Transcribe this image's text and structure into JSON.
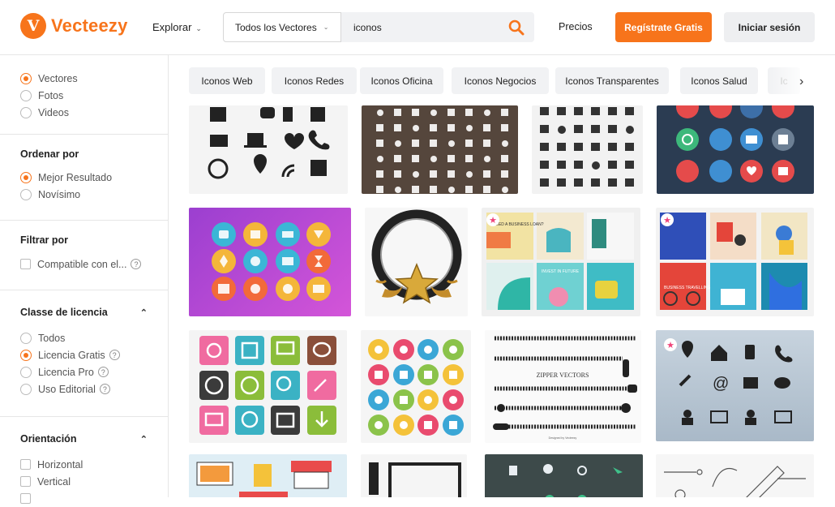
{
  "header": {
    "logo_mark": "V",
    "logo_text": "Vecteezy",
    "explore_label": "Explorar",
    "search_type": "Todos los Vectores",
    "search_value": "iconos",
    "prices_label": "Precios",
    "register_label": "Regístrate Gratis",
    "login_label": "Iniciar sesión",
    "accent_color": "#f7741b"
  },
  "sidebar": {
    "type": {
      "options": [
        "Vectores",
        "Fotos",
        "Videos"
      ],
      "selected": "Vectores"
    },
    "order": {
      "title": "Ordenar por",
      "options": [
        "Mejor Resultado",
        "Novísimo"
      ],
      "selected": "Mejor Resultado"
    },
    "filter": {
      "title": "Filtrar por",
      "option": "Compatible con el..."
    },
    "license": {
      "title": "Classe de licencia",
      "options": [
        "Todos",
        "Licencia Gratis",
        "Licencia Pro",
        "Uso Editorial"
      ],
      "selected": "Licencia Gratis"
    },
    "orientation": {
      "title": "Orientación",
      "options": [
        "Horizontal",
        "Vertical"
      ]
    }
  },
  "tags": [
    "Iconos Web",
    "Iconos Redes",
    "Iconos Oficina",
    "Iconos Negocios",
    "Iconos Transparentes",
    "Iconos Salud",
    "Ic"
  ],
  "results": {
    "zipper_caption": "ZIPPER VECTORS",
    "business_caption": "NEED A BUSINESS LOAN?",
    "business_caption2": "INVEST IN FUTURE",
    "social_caption": "BUSINESS TRAVELLING",
    "credit_caption": "Designed by Vecteezy"
  }
}
